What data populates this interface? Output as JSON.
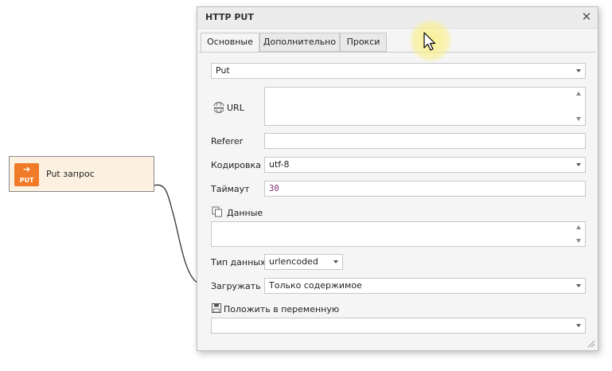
{
  "node": {
    "label": "Put запрос",
    "icon": "put-action-icon",
    "icon_text": "PUT",
    "accent": "#f07a27"
  },
  "dialog": {
    "title": "HTTP PUT",
    "tabs": [
      "Основные",
      "Дополнительно",
      "Прокси"
    ],
    "active_tab": 0,
    "method": {
      "value": "Put"
    },
    "url": {
      "label": "URL",
      "value": ""
    },
    "referer": {
      "label": "Referer",
      "value": ""
    },
    "encoding": {
      "label": "Кодировка",
      "value": "utf-8"
    },
    "timeout": {
      "label": "Таймаут",
      "value": "30"
    },
    "data": {
      "label": "Данные",
      "value": ""
    },
    "data_type": {
      "label": "Тип данных",
      "value": "urlencoded"
    },
    "load": {
      "label": "Загружать",
      "value": "Только содержимое"
    },
    "save_to": {
      "label": "Положить в переменную",
      "value": ""
    }
  }
}
